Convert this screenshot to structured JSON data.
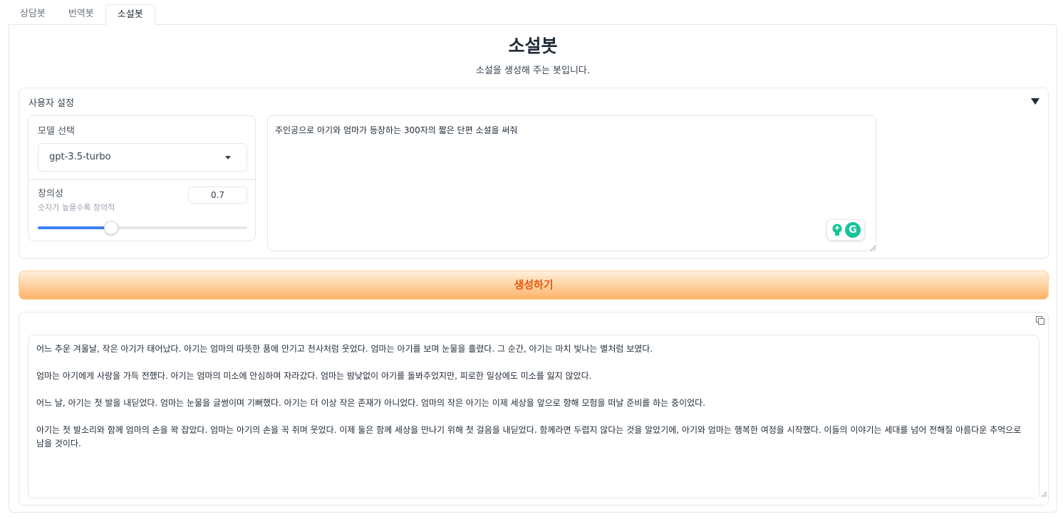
{
  "tabs": [
    "상담봇",
    "번역봇",
    "소설봇"
  ],
  "active_tab": 2,
  "page": {
    "title": "소설봇",
    "subtitle": "소설을 생성해 주는 봇입니다."
  },
  "settings": {
    "label": "사용자 설정",
    "model": {
      "label": "모델 선택",
      "selected": "gpt-3.5-turbo"
    },
    "temperature": {
      "label": "창의성",
      "info": "숫자가 높을수록 창의적",
      "value": "0.7",
      "fraction": 0.35
    }
  },
  "prompt": {
    "value": "주인공으로 아기와 엄마가 등장하는 300자의 짧은 단편 소설을 써줘"
  },
  "generate_button": {
    "label": "생성하기"
  },
  "output": {
    "text": "어느 추운 겨울날, 작은 아기가 태어났다. 아기는 엄마의 따뜻한 품에 안기고 천사처럼 웃었다. 엄마는 아기를 보며 눈물을 흘렸다. 그 순간, 아기는 마치 빛나는 별처럼 보였다.\n\n엄마는 아기에게 사랑을 가득 전했다. 아기는 엄마의 미소에 안심하며 자라갔다. 엄마는 밤낮없이 아기를 돌봐주었지만, 피로한 일상에도 미소를 잃지 않았다.\n\n어느 날, 아기는 첫 발을 내딛었다. 엄마는 눈물을 글썽이며 기뻐했다. 아기는 더 이상 작은 존재가 아니었다. 엄마의 작은 아기는 이제 세상을 앞으로 향해 모험을 떠날 준비를 하는 중이었다.\n\n아기는 첫 발소리와 함께 엄마의 손을 꽉 잡았다. 엄마는 아기의 손을 꼭 쥐며 웃었다. 이제 둘은 함께 세상을 만나기 위해 첫 걸음을 내딛었다. 함께라면 두렵지 않다는 것을 알았기에, 아기와 엄마는 행복한 여정을 시작했다. 이들의 이야기는 세대를 넘어 전해질 아름다운 추억으로 남을 것이다."
  },
  "colors": {
    "accent": "#3b82f6",
    "button_text": "#ea580c",
    "button_bg_top": "#fff0dc",
    "button_bg_bottom": "#fdb367",
    "grammarly": "#15c39a"
  }
}
